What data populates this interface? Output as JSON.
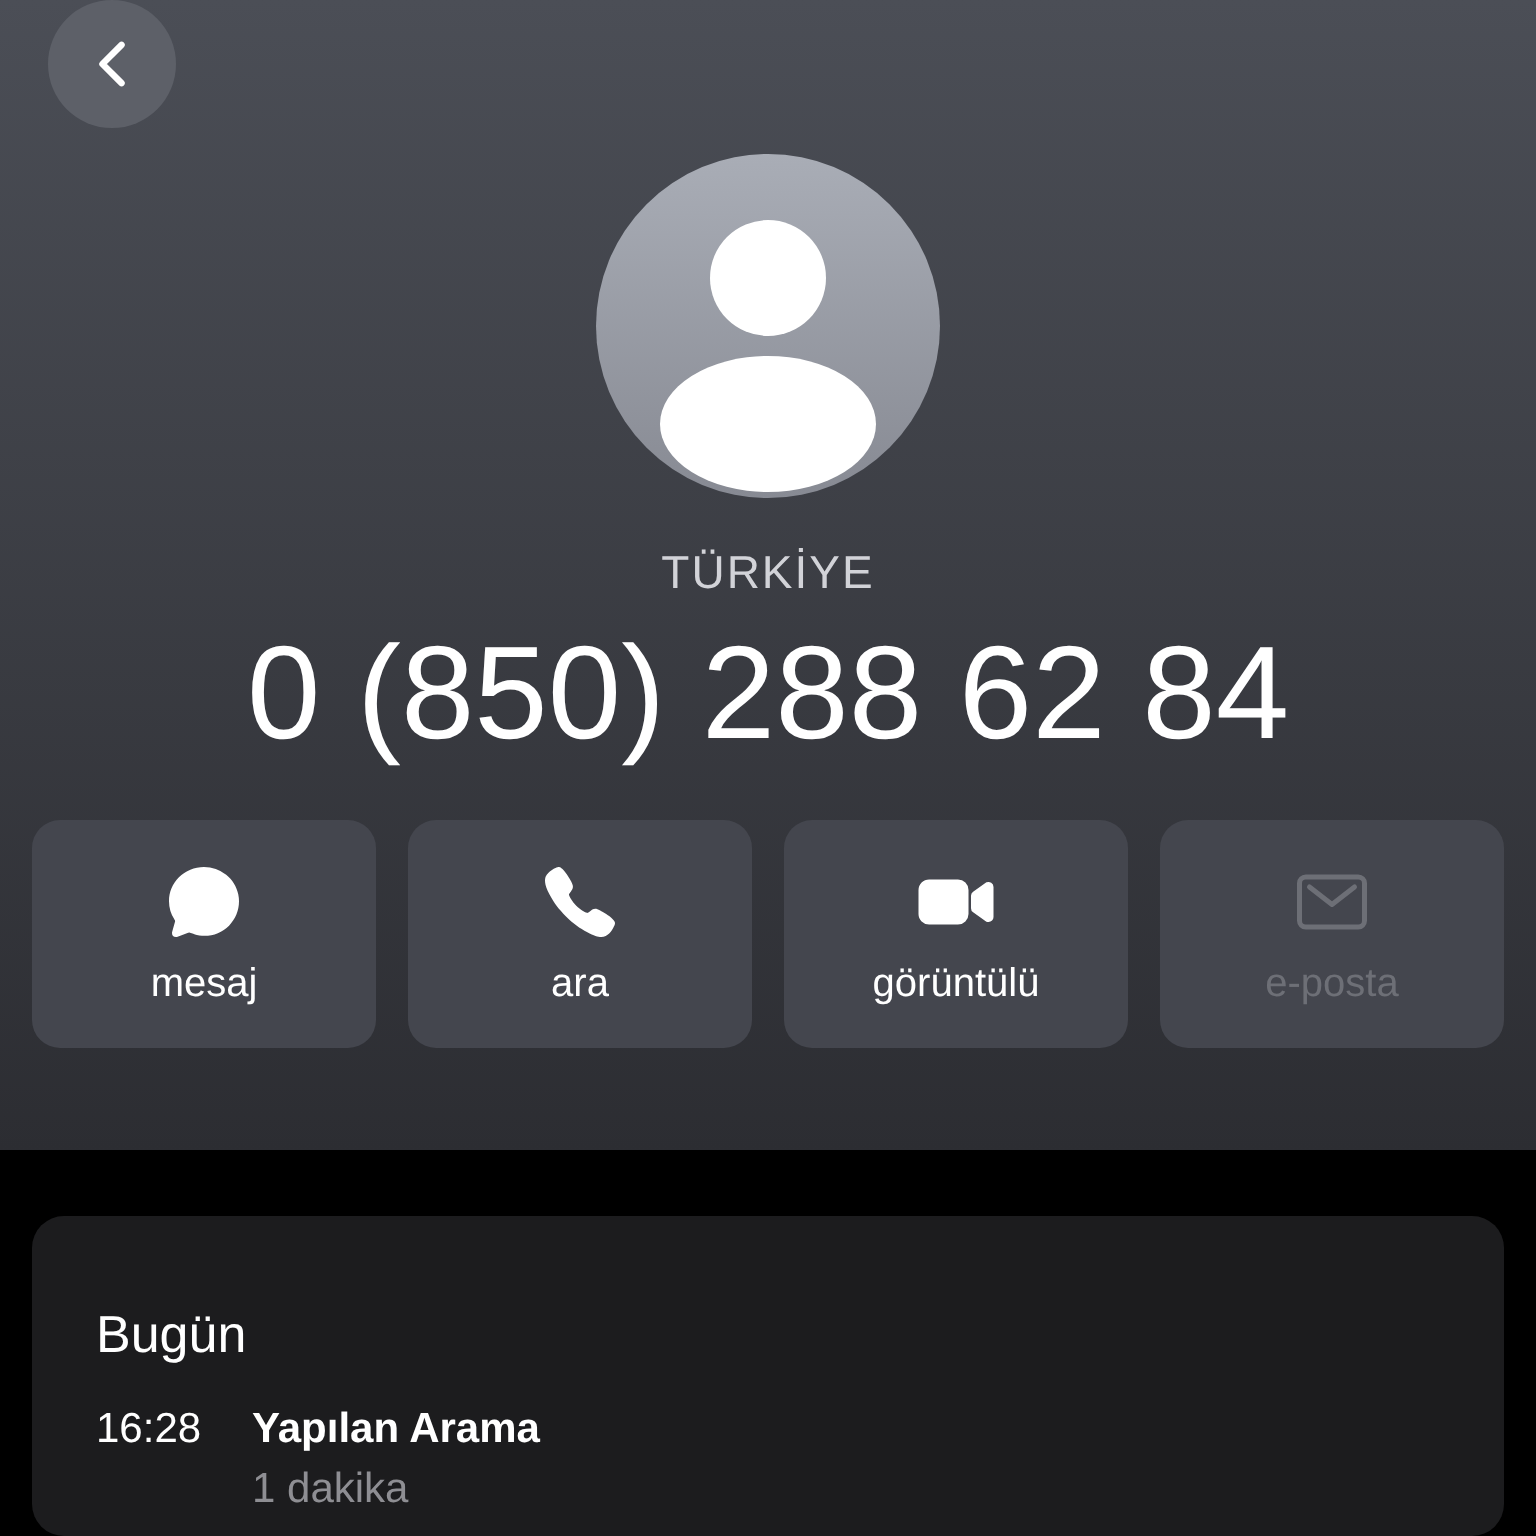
{
  "header": {
    "country": "TÜRKİYE",
    "phone": "0 (850) 288 62 84"
  },
  "actions": [
    {
      "kind": "message",
      "label": "mesaj",
      "disabled": false
    },
    {
      "kind": "call",
      "label": "ara",
      "disabled": false
    },
    {
      "kind": "video",
      "label": "görüntülü",
      "disabled": false
    },
    {
      "kind": "mail",
      "label": "e-posta",
      "disabled": true
    }
  ],
  "history": {
    "title": "Bugün",
    "calls": [
      {
        "time": "16:28",
        "type": "Yapılan Arama",
        "duration": "1 dakika"
      }
    ]
  }
}
